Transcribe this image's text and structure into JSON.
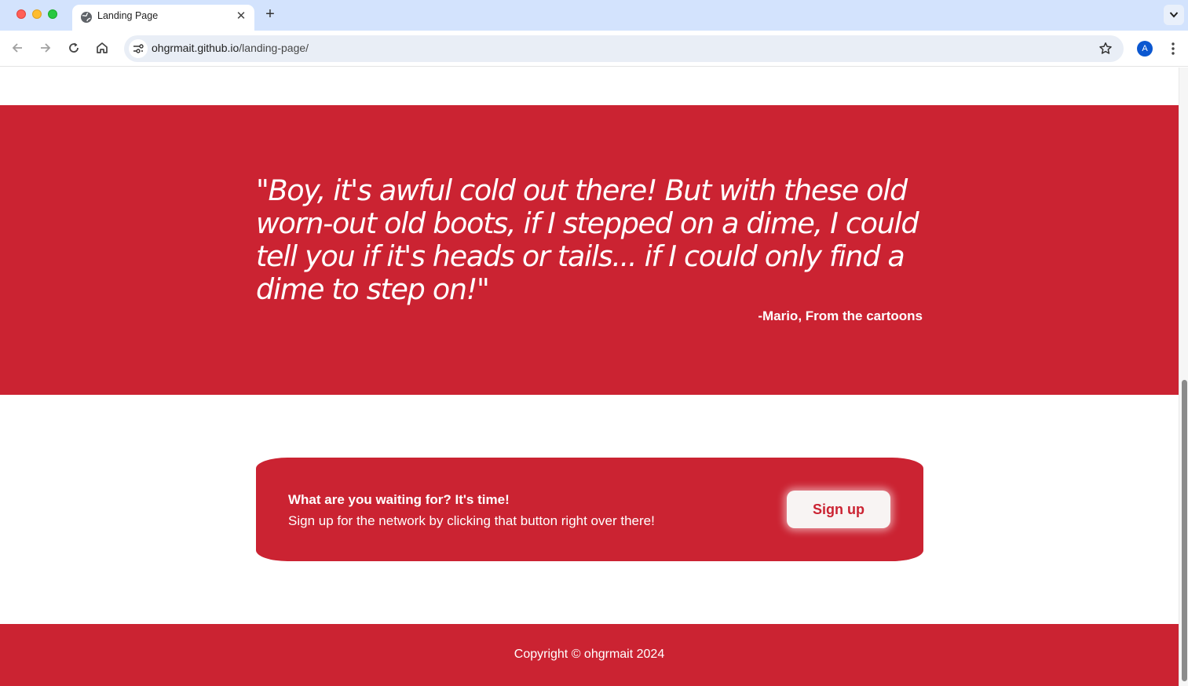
{
  "browser": {
    "tab_title": "Landing Page",
    "new_tab": "+",
    "tab_close": "✕",
    "url_host": "ohgrmait.github.io",
    "url_path": "/landing-page/",
    "avatar_letter": "A"
  },
  "quote": {
    "text": "\"Boy, it's awful cold out there! But with these old worn-out old boots, if I stepped on a dime, I could tell you if it's heads or tails... if I could only find a dime to step on!\"",
    "author": "-Mario, From the cartoons"
  },
  "cta": {
    "heading": "What are you waiting for? It's time!",
    "subtext": "Sign up for the network by clicking that button right over there!",
    "button_label": "Sign up"
  },
  "footer": {
    "copyright": "Copyright © ohgrmait 2024"
  },
  "colors": {
    "brand_red": "#cb2332",
    "chrome_blue": "#d3e3fd",
    "button_bg": "#f8f4f3"
  }
}
